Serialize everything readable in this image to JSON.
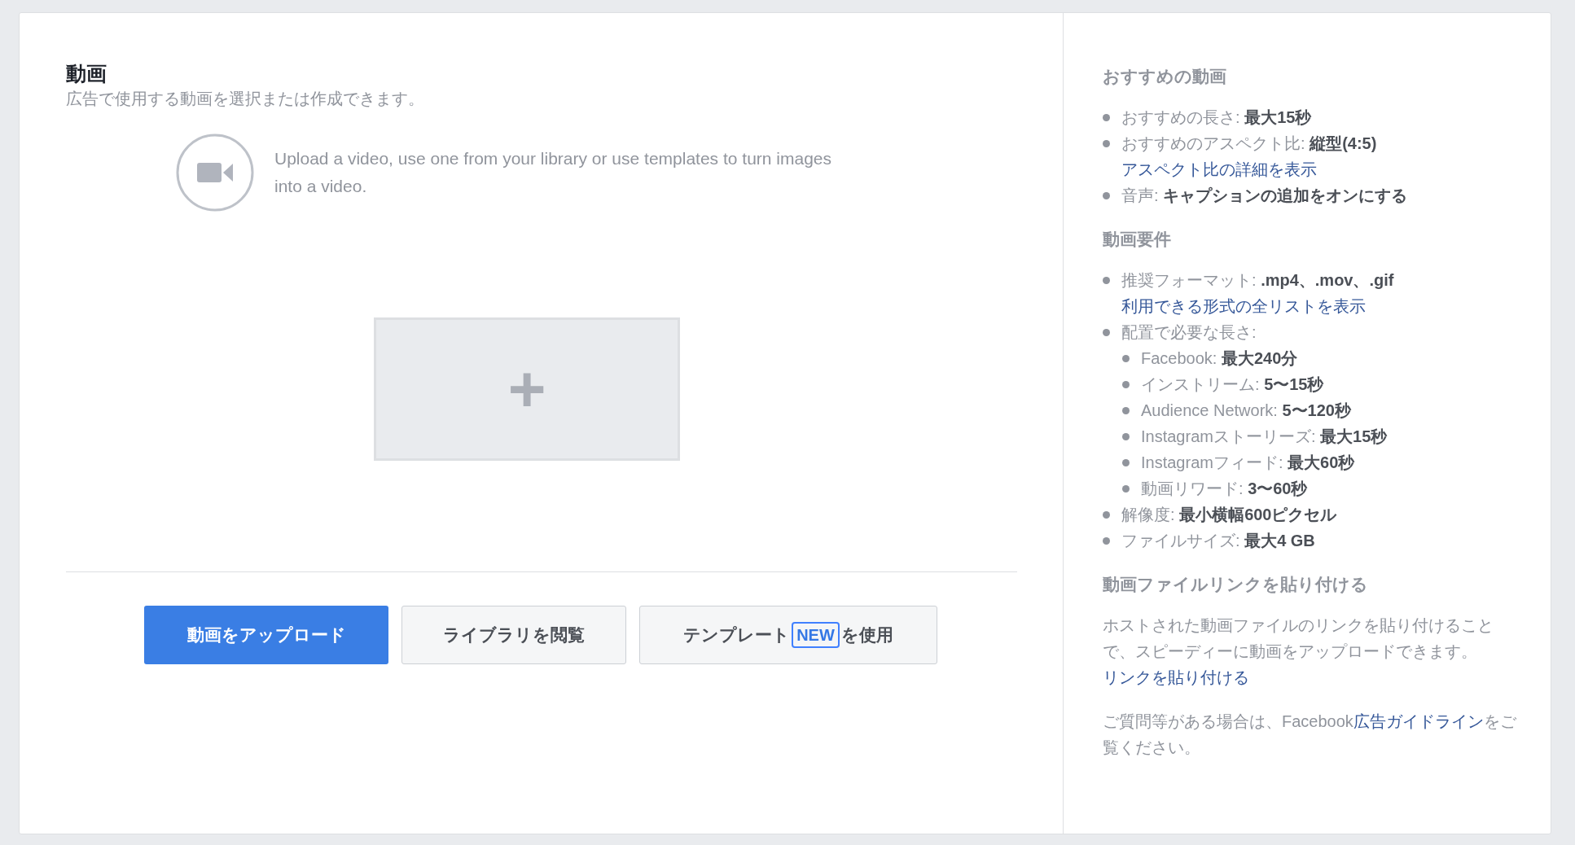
{
  "main": {
    "title": "動画",
    "subtitle": "広告で使用する動画を選択または作成できます。",
    "hint": "Upload a video, use one from your library or use templates to turn images into a video.",
    "add_tile": {
      "symbol": "+"
    },
    "buttons": [
      {
        "kind": "primary",
        "label": "動画をアップロード"
      },
      {
        "kind": "secondary",
        "label": "ライブラリを閲覧"
      },
      {
        "kind": "badge",
        "label": "テンプレート",
        "badge": "NEW",
        "suffix": "を使用"
      }
    ]
  },
  "sidebar": {
    "sections": [
      {
        "kind": "list",
        "heading": "おすすめの動画",
        "items": [
          {
            "text": "おすすめの長さ: **最大15秒**"
          },
          {
            "text": "おすすめのアスペクト比: **縦型(4:5)**",
            "link": "アスペクト比の詳細を表示"
          },
          {
            "text": "音声: **キャプションの追加をオンにする**"
          }
        ]
      },
      {
        "kind": "list",
        "heading": "動画要件",
        "items": [
          {
            "text": "推奨フォーマット: **.mp4、.mov、.gif**",
            "link": "利用できる形式の全リストを表示"
          },
          {
            "text": "配置で必要な長さ:",
            "children": [
              {
                "text": "Facebook: **最大240分**"
              },
              {
                "text": "インストリーム: **5〜15秒**"
              },
              {
                "text": "Audience Network: **5〜120秒**"
              },
              {
                "text": "Instagramストーリーズ: **最大15秒**"
              },
              {
                "text": "Instagramフィード: **最大60秒**"
              },
              {
                "text": "動画リワード: **3〜60秒**"
              }
            ]
          },
          {
            "text": "解像度: **最小横幅600ピクセル**"
          },
          {
            "text": "ファイルサイズ: **最大4 GB**"
          }
        ]
      },
      {
        "kind": "text",
        "heading": "動画ファイルリンクを貼り付ける",
        "body": "ホストされた動画ファイルのリンクを貼り付けることで、スピーディーに動画をアップロードできます。",
        "link": "リンクを貼り付ける"
      }
    ],
    "footer": {
      "before": "ご質問等がある場合は、Facebook",
      "link": "広告ガイドライン",
      "after": "をご覧ください。"
    }
  }
}
